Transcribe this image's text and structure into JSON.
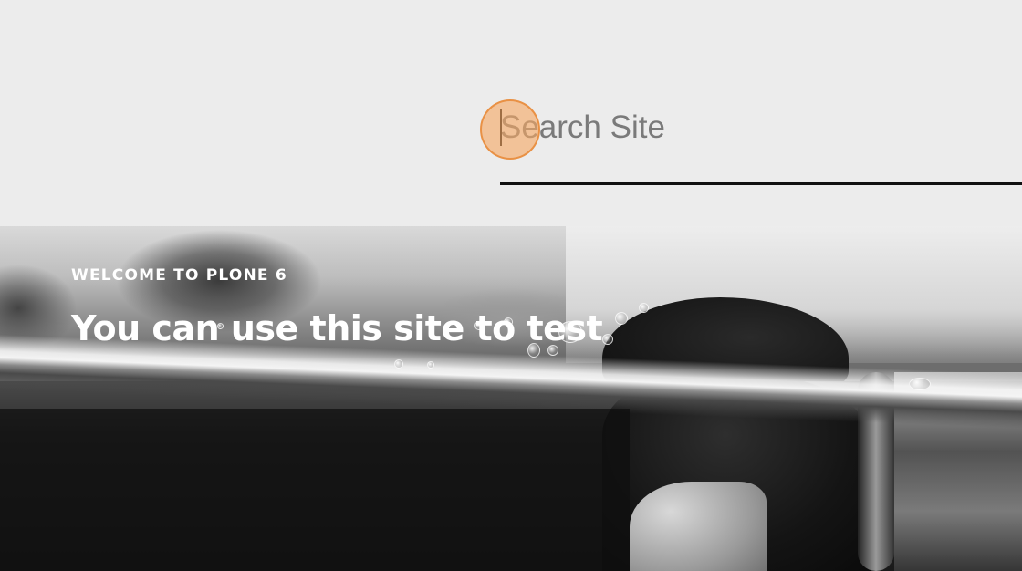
{
  "search": {
    "placeholder": "Search Site",
    "value": ""
  },
  "hero": {
    "eyebrow": "WELCOME TO PLONE 6",
    "title": "You can use this site to test"
  },
  "colors": {
    "page_background": "#ececec",
    "underline": "#111111",
    "click_marker": "#f5a864",
    "hero_text": "#ffffff",
    "hero_overlay": "#121212"
  }
}
